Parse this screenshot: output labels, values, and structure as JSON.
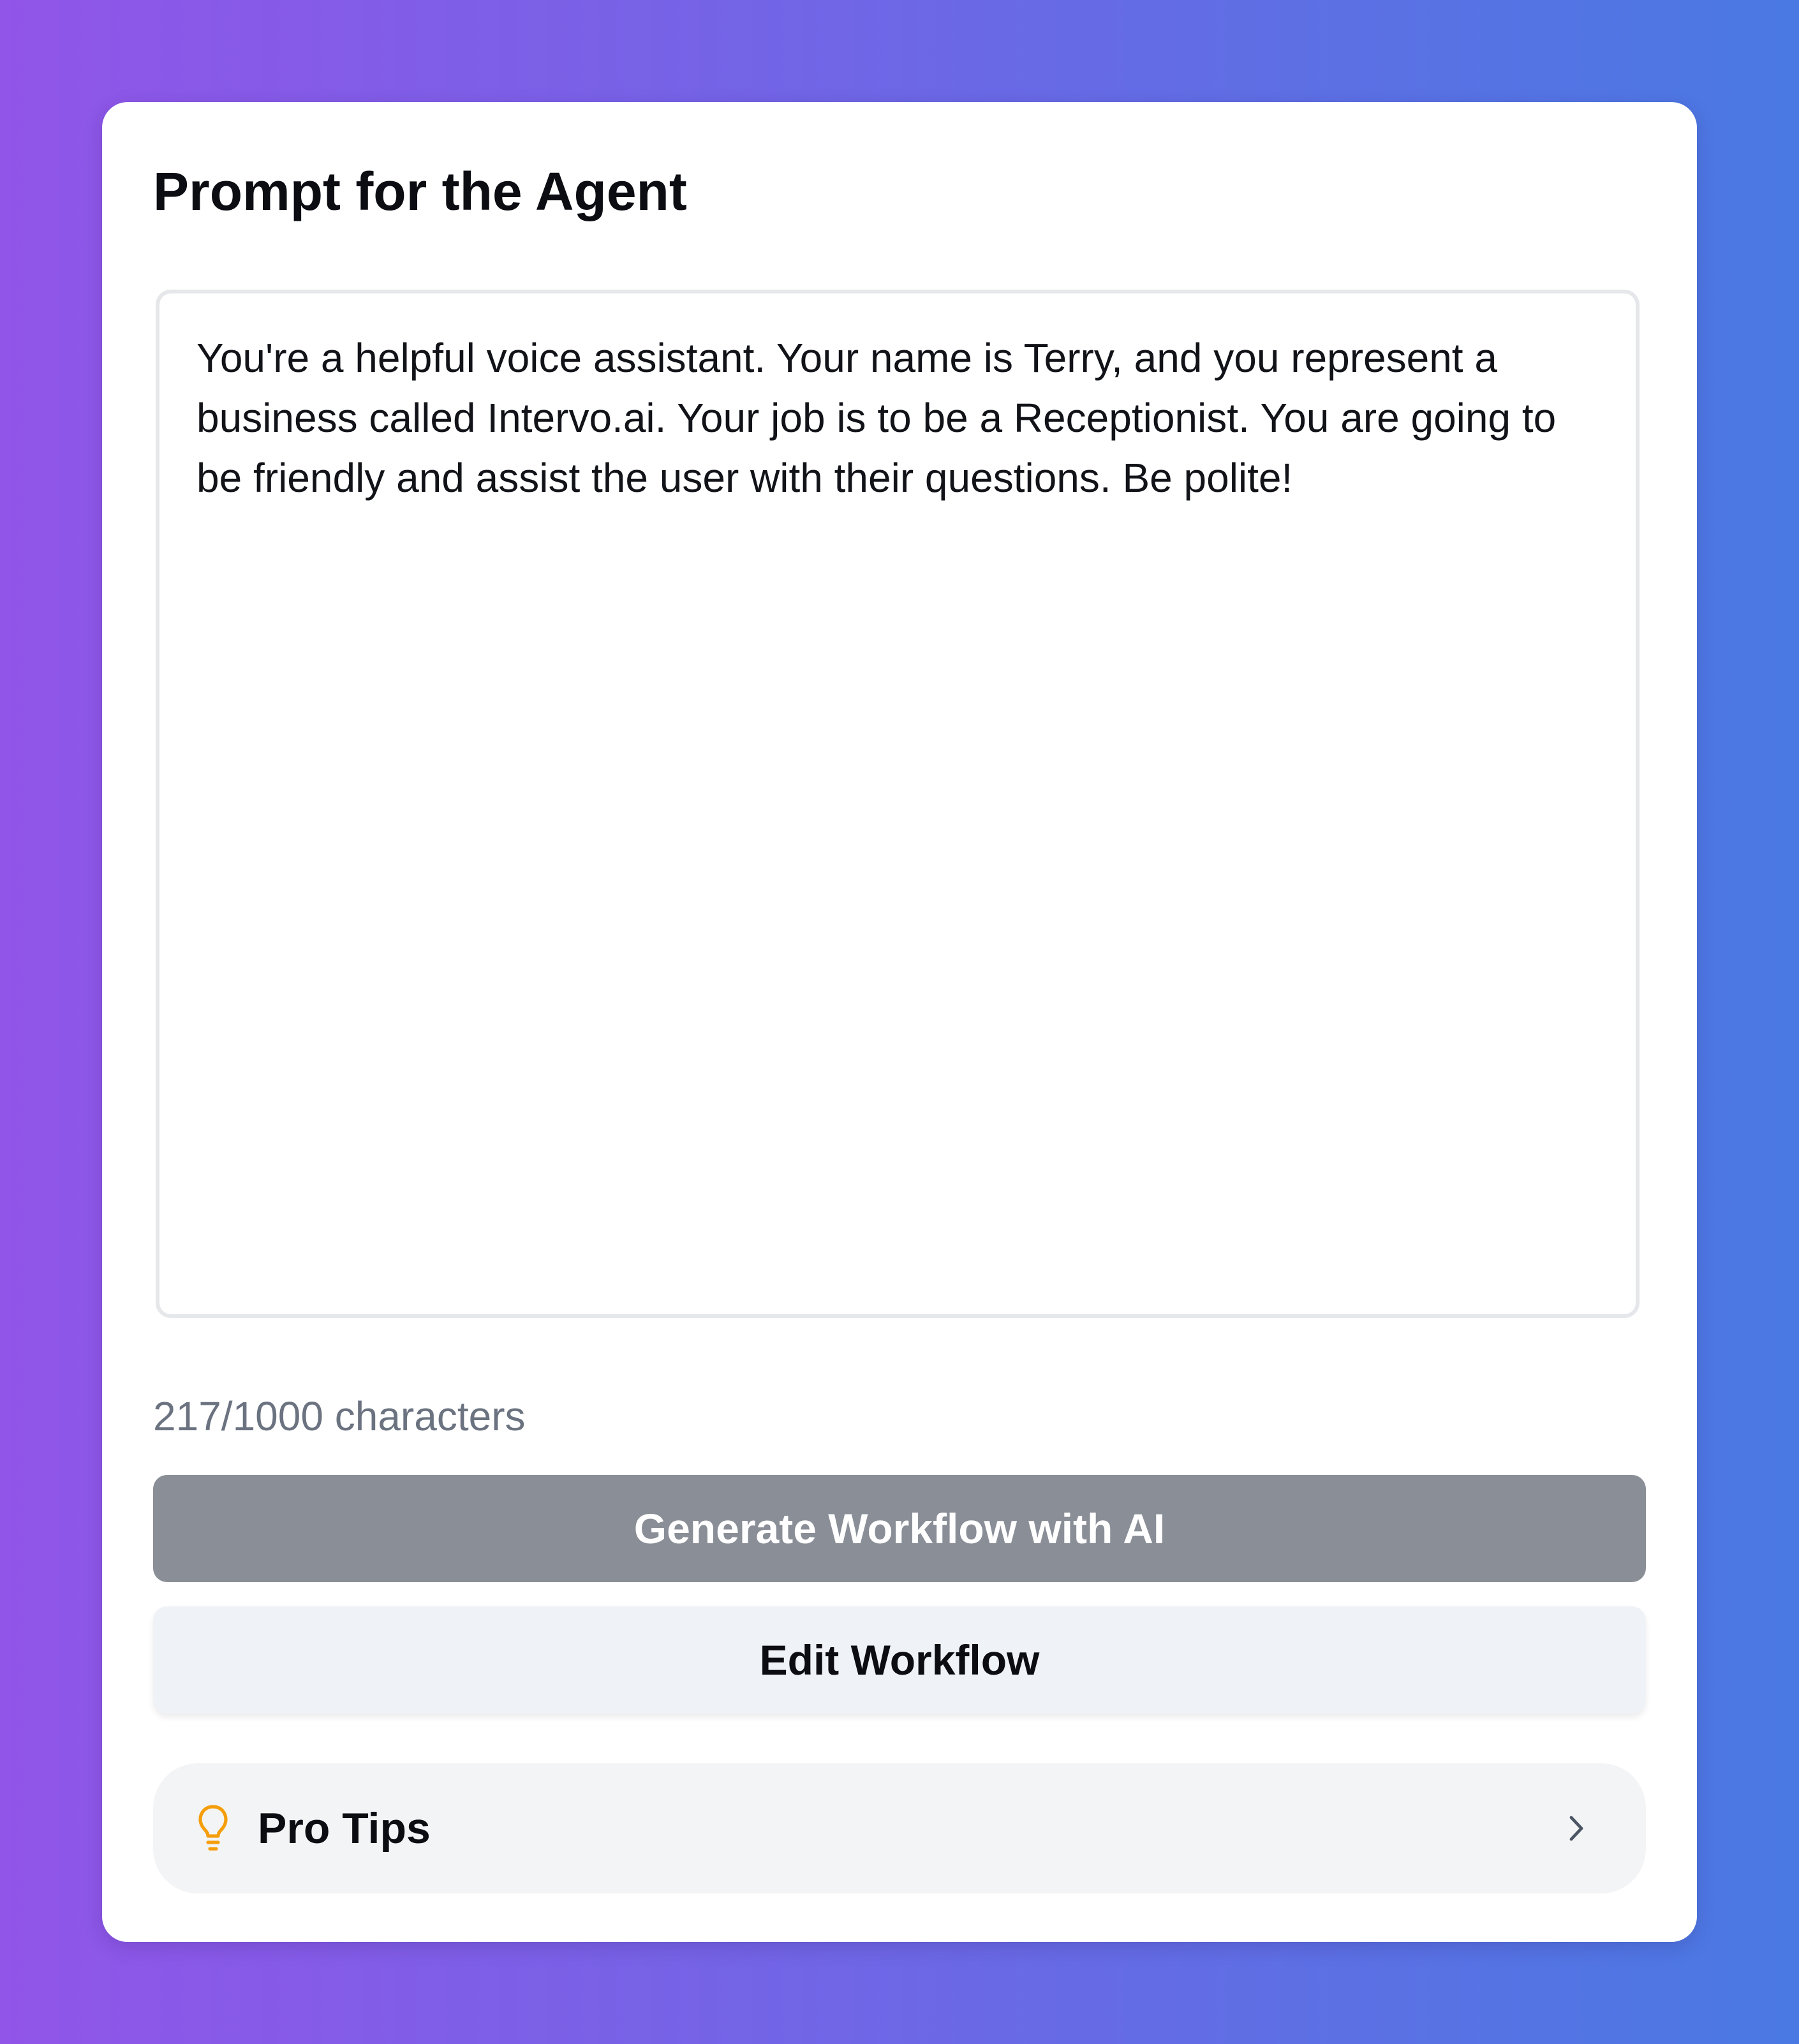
{
  "card": {
    "title": "Prompt for the Agent"
  },
  "prompt": {
    "value": "You're a helpful voice assistant. Your name is Terry, and you represent a business called Intervo.ai. Your job is to be a Receptionist. You are going to be friendly and assist the user with their questions. Be polite!",
    "char_count_label": "217/1000 characters"
  },
  "actions": {
    "generate_label": "Generate Workflow with AI",
    "edit_label": "Edit Workflow"
  },
  "pro_tips": {
    "label": "Pro Tips",
    "icon": "lightbulb-icon",
    "chevron_icon": "chevron-right-icon"
  },
  "colors": {
    "background_gradient_start": "#9155e8",
    "background_gradient_end": "#4a79e3",
    "generate_button": "#8a8e97",
    "edit_button": "#eff2f6",
    "bulb_accent": "#f59e0b"
  }
}
